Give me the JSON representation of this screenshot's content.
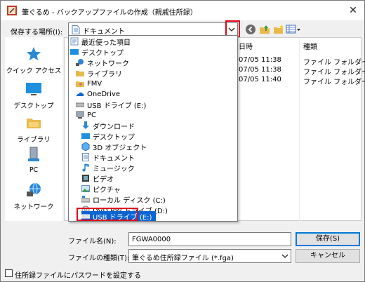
{
  "window": {
    "title": "筆ぐるめ - バックアップファイルの作成（親戚住所録）"
  },
  "toolbar": {
    "save_location_label": "保存する場所(I):",
    "location_value": "ドキュメント"
  },
  "places": [
    {
      "label": "クイック アクセス",
      "icon": "star-icon"
    },
    {
      "label": "デスクトップ",
      "icon": "desktop-icon"
    },
    {
      "label": "ライブラリ",
      "icon": "library-icon"
    },
    {
      "label": "PC",
      "icon": "pc-icon"
    },
    {
      "label": "ネットワーク",
      "icon": "network-icon"
    }
  ],
  "filelist": {
    "columns": [
      "日時",
      "種類"
    ],
    "rows": [
      {
        "date": "07/05 11:38",
        "type": "ファイル フォルダー"
      },
      {
        "date": "07/05 11:38",
        "type": "ファイル フォルダー"
      },
      {
        "date": "07/05 11:40",
        "type": "ファイル フォルダー"
      }
    ]
  },
  "dropdown": {
    "items": [
      {
        "label": "最近使った項目",
        "icon": "recent-icon"
      },
      {
        "label": "デスクトップ",
        "icon": "desktop-icon"
      },
      {
        "label": "ネットワーク",
        "icon": "network-icon"
      },
      {
        "label": "ライブラリ",
        "icon": "library-icon"
      },
      {
        "label": "FMV",
        "icon": "user-icon"
      },
      {
        "label": "OneDrive",
        "icon": "onedrive-icon"
      },
      {
        "label": "USB ドライブ (E:)",
        "icon": "usb-drive-icon"
      },
      {
        "label": "PC",
        "icon": "pc-icon"
      },
      {
        "label": "ダウンロード",
        "icon": "download-icon"
      },
      {
        "label": "デスクトップ",
        "icon": "desktop-icon"
      },
      {
        "label": "3D オブジェクト",
        "icon": "cube-icon"
      },
      {
        "label": "ドキュメント",
        "icon": "document-icon"
      },
      {
        "label": "ミュージック",
        "icon": "music-icon"
      },
      {
        "label": "ビデオ",
        "icon": "video-icon"
      },
      {
        "label": "ピクチャ",
        "icon": "picture-icon"
      },
      {
        "label": "ローカル ディスク (C:)",
        "icon": "local-disk-icon"
      },
      {
        "label": "DVD RW ドライブ (D:)",
        "icon": "dvd-icon"
      },
      {
        "label": "USB ドライブ (E:)",
        "icon": "usb-drive-icon"
      }
    ],
    "selected_index": 17
  },
  "footer": {
    "filename_label": "ファイル名(N):",
    "filename_value": "FGWA0000",
    "filetype_label": "ファイルの種類(T):",
    "filetype_value": "筆ぐるめ住所録ファイル (*.fga)",
    "save_button": "保存(S)",
    "cancel_button": "キャンセル",
    "password_checkbox_label": "住所録ファイルにパスワードを設定する"
  },
  "colors": {
    "selection": "#0a64d4",
    "highlight_box": "#e0001b"
  }
}
